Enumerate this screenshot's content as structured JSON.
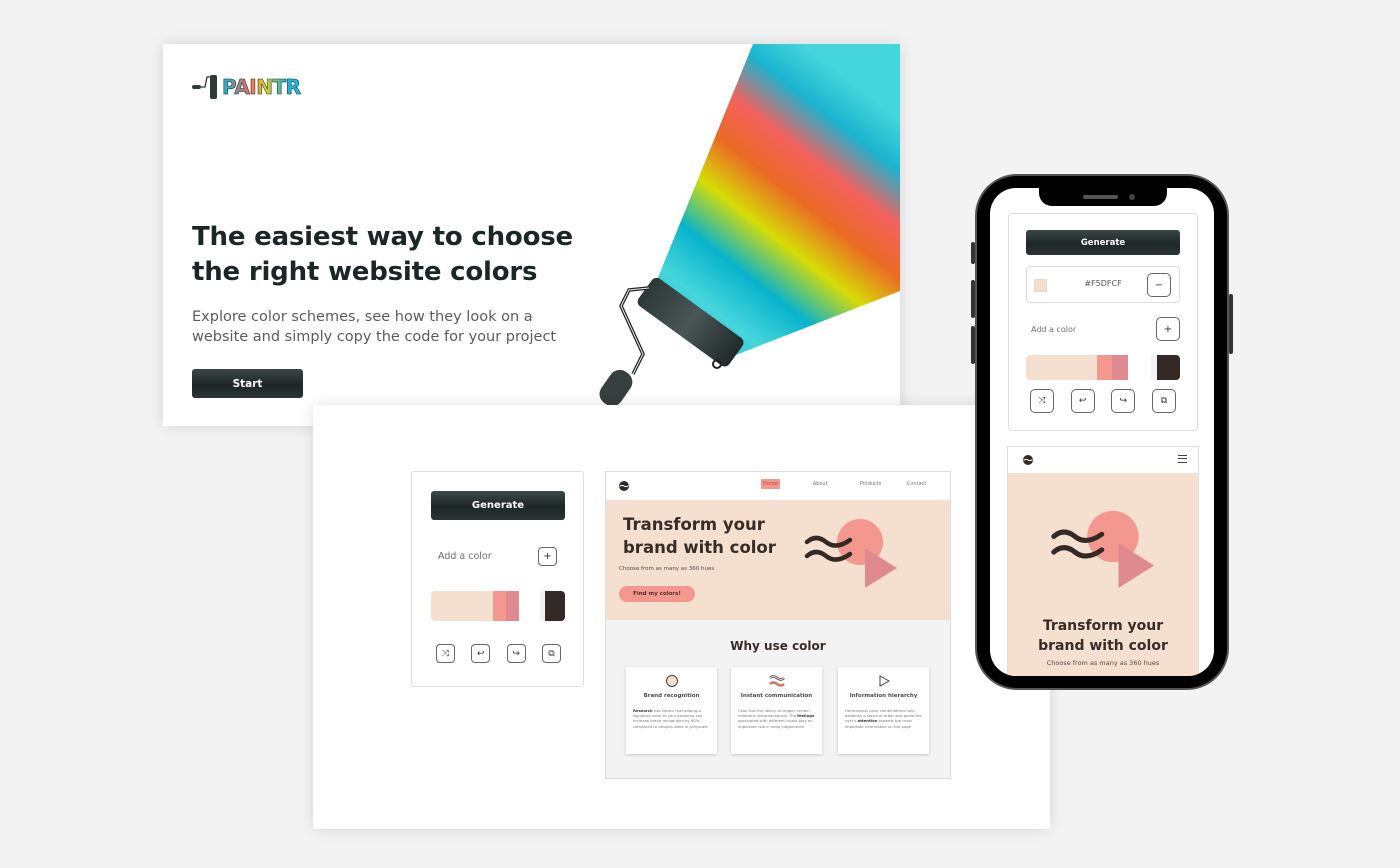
{
  "landing": {
    "logo_text": "PAINTR",
    "headline": "The easiest way to choose the right website colors",
    "subtitle": "Explore color schemes, see how they look on a website and simply copy the code for your project",
    "start_label": "Start"
  },
  "generator": {
    "generate_label": "Generate",
    "add_color_label": "Add a color",
    "add_icon": "+",
    "remove_icon": "−",
    "hex_value": "#F5DFCF",
    "palette": [
      {
        "color": "#F5DFCF",
        "weight": 46
      },
      {
        "color": "#F4978E",
        "weight": 10
      },
      {
        "color": "#DF8A8E",
        "weight": 10
      },
      {
        "color": "#FFFFFF",
        "weight": 15
      },
      {
        "color": "#F3F3F3",
        "weight": 4
      },
      {
        "color": "#342925",
        "weight": 15
      }
    ],
    "tools": [
      {
        "name": "shuffle-icon",
        "glyph": "⤨"
      },
      {
        "name": "undo-icon",
        "glyph": "↩"
      },
      {
        "name": "redo-icon",
        "glyph": "↪"
      },
      {
        "name": "copy-icon",
        "glyph": "⧉"
      }
    ]
  },
  "preview_site": {
    "nav": [
      "Home",
      "About",
      "Products",
      "Contact"
    ],
    "hero_title": "Transform your brand with color",
    "hero_subtitle": "Choose from as many as 360 hues",
    "cta_label": "Find my colors!",
    "section_title": "Why use color",
    "cards": [
      {
        "title": "Brand recognition",
        "bold": "Research",
        "text": " has shown that adding a signature color to your branding can increase brand recognition by 80%, compared to designs done in grayscale"
      },
      {
        "title": "Instant communication",
        "pre": "Color has the ability to trigger certain emotions instantaneously. The ",
        "bold": "feelings",
        "text": " associated with different colors play an important role in snap judgements"
      },
      {
        "title": "Information hierarchy",
        "pre": "Harmonious color combinations help establish a sense of order and guide the user's ",
        "bold": "attention",
        "text": " towards the most important information on the page"
      }
    ]
  },
  "colors": {
    "background": "#F3F3F3",
    "dark": "#1D2727",
    "peach": "#F5DFCF",
    "salmon": "#F4978E",
    "rose": "#DF8A8E",
    "brown": "#342925"
  }
}
